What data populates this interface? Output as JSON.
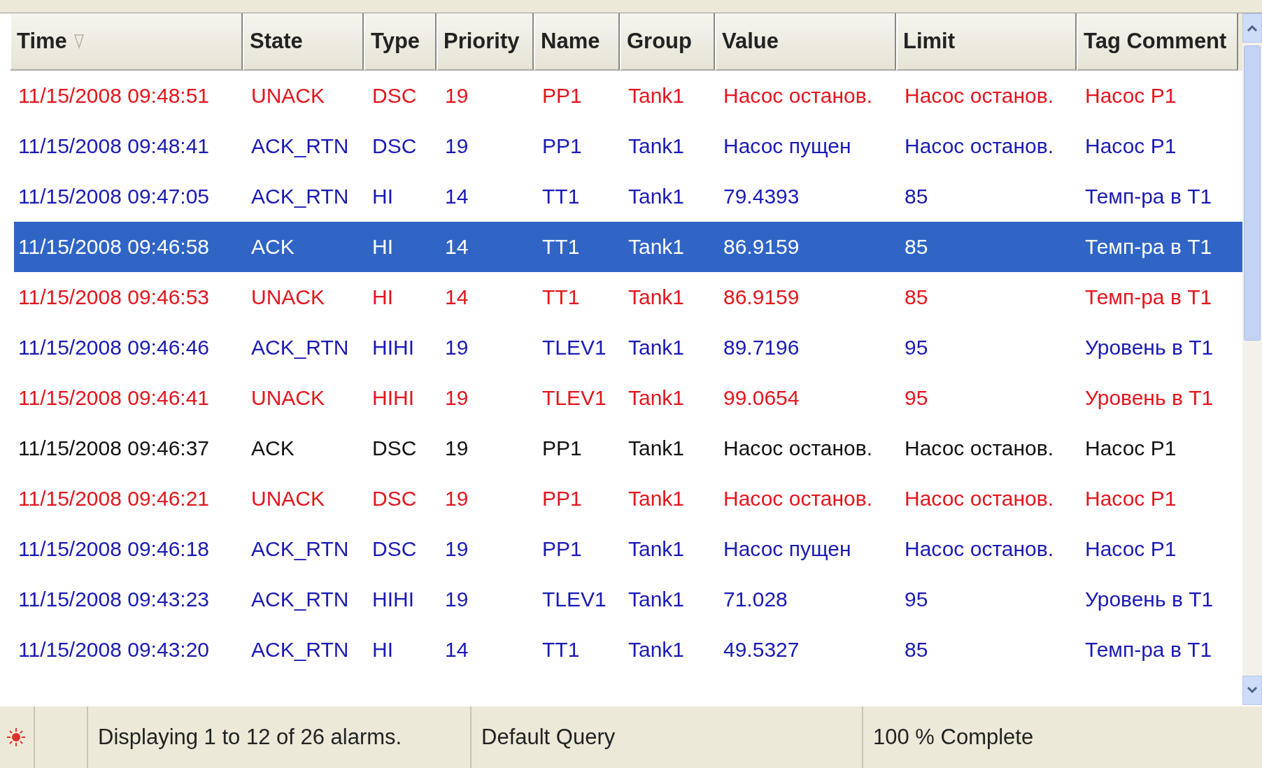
{
  "columns": [
    {
      "label": "Time",
      "sorted": true
    },
    {
      "label": "State",
      "sorted": false
    },
    {
      "label": "Type",
      "sorted": false
    },
    {
      "label": "Priority",
      "sorted": false
    },
    {
      "label": "Name",
      "sorted": false
    },
    {
      "label": "Group",
      "sorted": false
    },
    {
      "label": "Value",
      "sorted": false
    },
    {
      "label": "Limit",
      "sorted": false
    },
    {
      "label": "Tag Comment",
      "sorted": false
    }
  ],
  "rows": [
    {
      "selected": false,
      "color": "#e3151d",
      "cells": [
        "11/15/2008 09:48:51",
        "UNACK",
        "DSC",
        "19",
        "PP1",
        "Tank1",
        "Насос останов.",
        "Насос останов.",
        "Насос P1"
      ]
    },
    {
      "selected": false,
      "color": "#1a1ab4",
      "cells": [
        "11/15/2008 09:48:41",
        "ACK_RTN",
        "DSC",
        "19",
        "PP1",
        "Tank1",
        "Насос пущен",
        "Насос останов.",
        "Насос P1"
      ]
    },
    {
      "selected": false,
      "color": "#1a1ab4",
      "cells": [
        "11/15/2008 09:47:05",
        "ACK_RTN",
        "HI",
        "14",
        "TT1",
        "Tank1",
        "79.4393",
        "85",
        "Темп-ра в T1"
      ]
    },
    {
      "selected": true,
      "color": "#ffffff",
      "cells": [
        "11/15/2008 09:46:58",
        "ACK",
        "HI",
        "14",
        "TT1",
        "Tank1",
        "86.9159",
        "85",
        "Темп-ра в T1"
      ]
    },
    {
      "selected": false,
      "color": "#e3151d",
      "cells": [
        "11/15/2008 09:46:53",
        "UNACK",
        "HI",
        "14",
        "TT1",
        "Tank1",
        "86.9159",
        "85",
        "Темп-ра в T1"
      ]
    },
    {
      "selected": false,
      "color": "#1a1ab4",
      "cells": [
        "11/15/2008 09:46:46",
        "ACK_RTN",
        "HIHI",
        "19",
        "TLEV1",
        "Tank1",
        "89.7196",
        "95",
        "Уровень в T1"
      ]
    },
    {
      "selected": false,
      "color": "#e3151d",
      "cells": [
        "11/15/2008 09:46:41",
        "UNACK",
        "HIHI",
        "19",
        "TLEV1",
        "Tank1",
        "99.0654",
        "95",
        "Уровень в T1"
      ]
    },
    {
      "selected": false,
      "color": "#111111",
      "cells": [
        "11/15/2008 09:46:37",
        "ACK",
        "DSC",
        "19",
        "PP1",
        "Tank1",
        "Насос останов.",
        "Насос останов.",
        "Насос P1"
      ]
    },
    {
      "selected": false,
      "color": "#e3151d",
      "cells": [
        "11/15/2008 09:46:21",
        "UNACK",
        "DSC",
        "19",
        "PP1",
        "Tank1",
        "Насос останов.",
        "Насос останов.",
        "Насос P1"
      ]
    },
    {
      "selected": false,
      "color": "#1a1ab4",
      "cells": [
        "11/15/2008 09:46:18",
        "ACK_RTN",
        "DSC",
        "19",
        "PP1",
        "Tank1",
        "Насос пущен",
        "Насос останов.",
        "Насос P1"
      ]
    },
    {
      "selected": false,
      "color": "#1a1ab4",
      "cells": [
        "11/15/2008 09:43:23",
        "ACK_RTN",
        "HIHI",
        "19",
        "TLEV1",
        "Tank1",
        "71.028",
        "95",
        "Уровень в T1"
      ]
    },
    {
      "selected": false,
      "color": "#1a1ab4",
      "cells": [
        "11/15/2008 09:43:20",
        "ACK_RTN",
        "HI",
        "14",
        "TT1",
        "Tank1",
        "49.5327",
        "85",
        "Темп-ра в T1"
      ]
    }
  ],
  "status_bar": {
    "message": "Displaying 1 to 12 of 26 alarms.",
    "query": "Default Query",
    "progress": "100 % Complete"
  }
}
